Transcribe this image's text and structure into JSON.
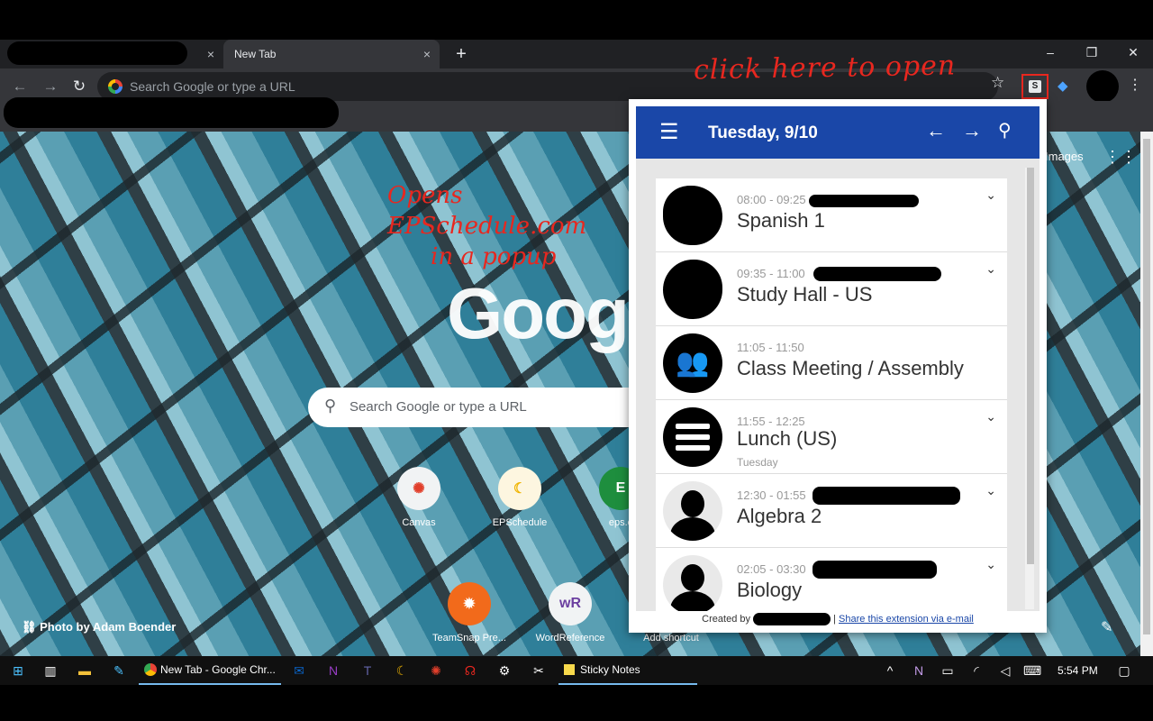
{
  "browser": {
    "tab_active_title": "New Tab",
    "tab_close_glyph": "×",
    "new_tab_glyph": "+",
    "win_minimize": "–",
    "win_restore": "❐",
    "win_close": "✕",
    "omnibox_placeholder": "Search Google or type a URL",
    "extension_letter": "S"
  },
  "annotations": {
    "click_here": "click here to open",
    "opens_line1": "Opens",
    "opens_line2": "EPSchedule.com",
    "opens_line3": "in a popup"
  },
  "ntp": {
    "logo_text": "Goog",
    "search_placeholder": "Search Google or type a URL",
    "images_link": "Images",
    "photo_credit": "Photo by Adam Boender",
    "shortcuts": [
      {
        "label": "Canvas",
        "glyph": "✺"
      },
      {
        "label": "EPSchedule",
        "glyph": "☾"
      },
      {
        "label": "eps.c",
        "glyph": "E"
      },
      {
        "label": "TeamSnap Pre...",
        "glyph": "✹"
      },
      {
        "label": "WordReference",
        "glyph": "wR"
      },
      {
        "label": "Add shortcut",
        "glyph": "+"
      }
    ]
  },
  "popup": {
    "date": "Tuesday, 9/10",
    "periods": [
      {
        "time": "08:00 - 09:25",
        "title": "Spanish 1",
        "sub": ""
      },
      {
        "time": "09:35 - 11:00",
        "title": "Study Hall - US",
        "sub": ""
      },
      {
        "time": "11:05 - 11:50",
        "title": "Class Meeting / Assembly",
        "sub": ""
      },
      {
        "time": "11:55 - 12:25",
        "title": "Lunch (US)",
        "sub": "Tuesday"
      },
      {
        "time": "12:30 - 01:55",
        "title": "Algebra 2",
        "sub": ""
      },
      {
        "time": "02:05 - 03:30",
        "title": "Biology",
        "sub": ""
      }
    ],
    "footer_created": "Created by",
    "footer_sep": "|",
    "footer_link": "Share this extension via e-mail"
  },
  "taskbar": {
    "apps": [
      {
        "label": "New Tab - Google Chr..."
      },
      {
        "label": "Sticky Notes"
      }
    ],
    "time": "5:54 PM"
  },
  "colors": {
    "annotation": "#e8271f",
    "popup_header": "#1a47a8",
    "chrome_dark": "#202124"
  }
}
